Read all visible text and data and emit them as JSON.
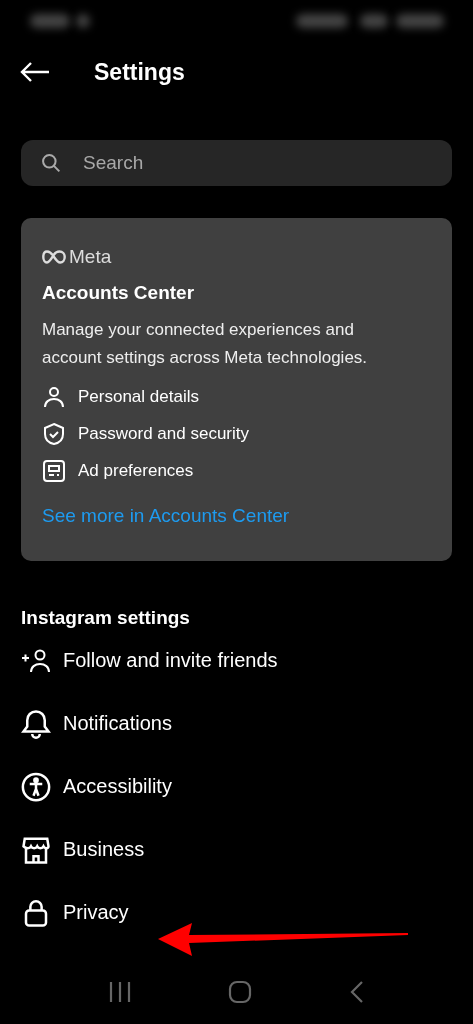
{
  "header": {
    "title": "Settings"
  },
  "search": {
    "placeholder": "Search"
  },
  "accounts_center": {
    "brand": "Meta",
    "title": "Accounts Center",
    "description": "Manage your connected experiences and account settings across Meta technologies.",
    "items": [
      {
        "kind": "person",
        "label": "Personal details"
      },
      {
        "kind": "shield",
        "label": "Password and security"
      },
      {
        "kind": "ad",
        "label": "Ad preferences"
      }
    ],
    "link": "See more in Accounts Center"
  },
  "section": {
    "title": "Instagram settings",
    "items": [
      {
        "kind": "add-person",
        "label": "Follow and invite friends"
      },
      {
        "kind": "bell",
        "label": "Notifications"
      },
      {
        "kind": "accessibility",
        "label": "Accessibility"
      },
      {
        "kind": "store",
        "label": "Business"
      },
      {
        "kind": "lock",
        "label": "Privacy"
      }
    ]
  }
}
